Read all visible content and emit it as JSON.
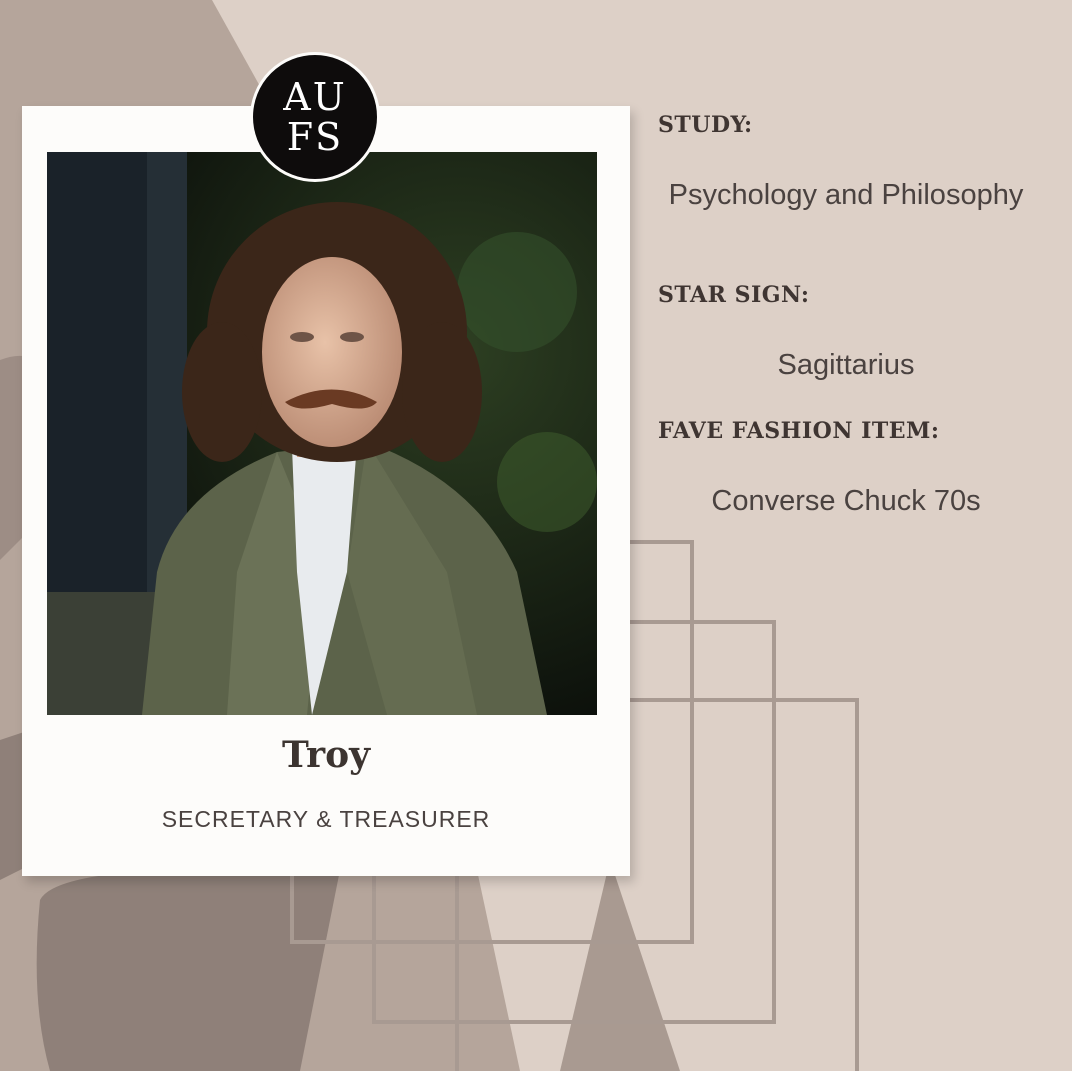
{
  "logo": {
    "text": "AUFS"
  },
  "member": {
    "name": "Troy",
    "role": "SECRETARY & TREASURER"
  },
  "fields": {
    "study_label": "STUDY:",
    "study_value": "Psychology and Philosophy",
    "star_label": "STAR SIGN:",
    "star_value": "Sagittarius",
    "fashion_label": "FAVE FASHION ITEM:",
    "fashion_value": "Converse Chuck 70s"
  },
  "colors": {
    "background": "#ddd0c7",
    "dark_shape": "#8f8079",
    "mid_shape": "#b5a59b",
    "frame": "#fdfcfa",
    "text": "#3f3532"
  }
}
